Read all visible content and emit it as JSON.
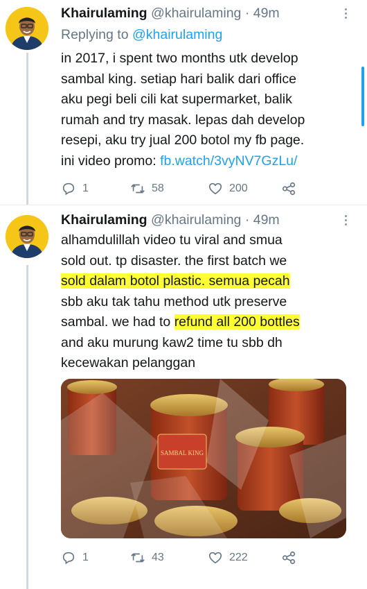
{
  "tweets": [
    {
      "name": "Khairulaming",
      "handle": "@khairulaming",
      "separator": "·",
      "time": "49m",
      "replying_prefix": "Replying to",
      "replying_to": "@khairulaming",
      "text_lines": [
        "in 2017, i spent two months utk develop",
        "sambal king. setiap hari balik dari office",
        "aku pegi beli cili kat supermarket, balik",
        "rumah and try masak. lepas dah develop",
        "resepi, aku try jual 200 botol my fb page."
      ],
      "text_last_prefix": "ini video promo: ",
      "text_link": "fb.watch/3vyNV7GzLu/",
      "replies": "1",
      "retweets": "58",
      "likes": "200"
    },
    {
      "name": "Khairulaming",
      "handle": "@khairulaming",
      "separator": "·",
      "time": "49m",
      "line1": "alhamdulillah video tu viral and smua",
      "line2": "sold out. tp disaster. the first batch we",
      "line3_highlight": "sold dalam botol plastic. semua pecah",
      "line4": "sbb aku tak tahu method utk preserve",
      "line5_prefix": "sambal. we had to ",
      "line5_highlight": "refund all 200 bottles",
      "line6": "and aku murung kaw2 time tu sbb dh",
      "line7": "kecewakan pelanggan",
      "image_jar_label": "SAMBAL KING",
      "replies": "1",
      "retweets": "43",
      "likes": "222"
    }
  ],
  "colors": {
    "link": "#1da1f2",
    "secondary_text": "#657786",
    "highlight": "#ffff33",
    "avatar_bg": "#f5c518"
  },
  "icons": [
    "reply-icon",
    "retweet-icon",
    "like-icon",
    "share-icon",
    "more-icon",
    "avatar"
  ]
}
